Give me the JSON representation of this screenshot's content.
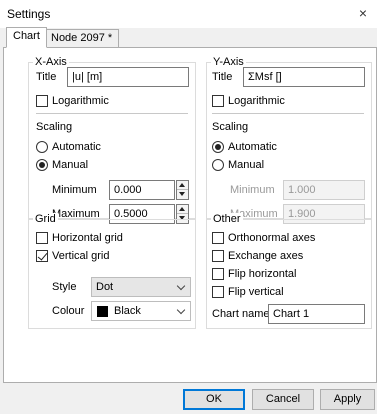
{
  "window": {
    "title": "Settings",
    "close_glyph": "×"
  },
  "tabs": [
    {
      "label": "Chart",
      "active": true
    },
    {
      "label": "Node 2097 *",
      "active": false
    }
  ],
  "x_axis": {
    "legend": "X-Axis",
    "title_label": "Title",
    "title_value": "|u| [m]",
    "logarithmic_label": "Logarithmic",
    "logarithmic": false,
    "scaling_label": "Scaling",
    "automatic_label": "Automatic",
    "manual_label": "Manual",
    "mode": "Manual",
    "minimum_label": "Minimum",
    "minimum_value": "0.000",
    "maximum_label": "Maximum",
    "maximum_value": "0.5000"
  },
  "y_axis": {
    "legend": "Y-Axis",
    "title_label": "Title",
    "title_value": "ΣMsf []",
    "logarithmic_label": "Logarithmic",
    "logarithmic": false,
    "scaling_label": "Scaling",
    "automatic_label": "Automatic",
    "manual_label": "Manual",
    "mode": "Automatic",
    "minimum_label": "Minimum",
    "minimum_value": "1.000",
    "maximum_label": "Maximum",
    "maximum_value": "1.900"
  },
  "grid": {
    "legend": "Grid",
    "horizontal_label": "Horizontal grid",
    "horizontal": false,
    "vertical_label": "Vertical grid",
    "vertical": true,
    "style_label": "Style",
    "style_value": "Dot",
    "colour_label": "Colour",
    "colour_value": "Black",
    "colour_swatch": "#000000"
  },
  "other": {
    "legend": "Other",
    "orthonormal_label": "Orthonormal axes",
    "exchange_label": "Exchange axes",
    "flip_horizontal_label": "Flip horizontal",
    "flip_vertical_label": "Flip vertical",
    "chart_name_label": "Chart name",
    "chart_name_value": "Chart 1"
  },
  "buttons": {
    "ok": "OK",
    "cancel": "Cancel",
    "apply": "Apply"
  },
  "colors": {
    "default_button_border": "#0078d7",
    "window_bg": "#f0f0f0"
  }
}
